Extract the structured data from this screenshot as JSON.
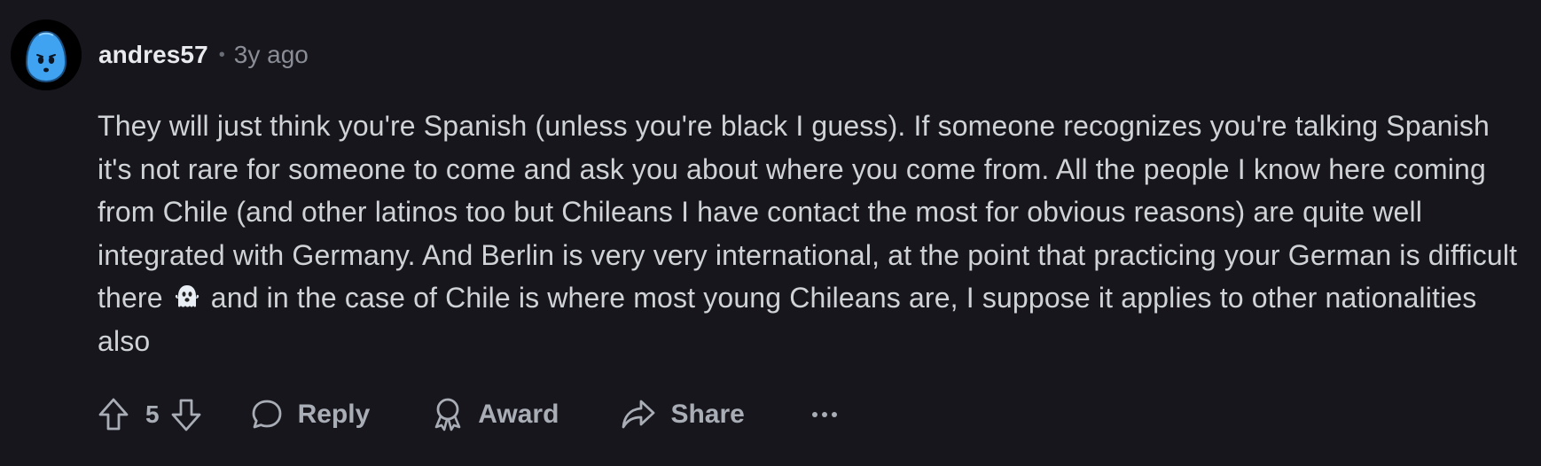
{
  "comment": {
    "author": "andres57",
    "separator": "•",
    "timestamp": "3y ago",
    "text_before_emoji": "They will just think you're Spanish (unless you're black I guess). If someone recognizes you're talking Spanish it's not rare for someone to come and ask you about where you come from. All the people I know here coming from Chile (and other latinos too but Chileans I have contact the most for obvious reasons) are quite well integrated with Germany. And Berlin is very very international, at the point that practicing your German is difficult there ",
    "emoji": "ghost-emoji",
    "text_after_emoji": " and in the case of Chile is where most young Chileans are, I suppose it applies to other nationalities also"
  },
  "actions": {
    "vote_count": "5",
    "reply_label": "Reply",
    "award_label": "Award",
    "share_label": "Share"
  },
  "icons": {
    "avatar": "snoo-avatar",
    "upvote": "arrow-up-icon",
    "downvote": "arrow-down-icon",
    "reply": "speech-bubble-icon",
    "award": "award-ribbon-icon",
    "share": "share-arrow-icon",
    "more": "ellipsis-icon"
  },
  "colors": {
    "background": "#17161d",
    "avatar_bg": "#000000",
    "avatar_head": "#3fa3f2",
    "text": "#d0d3d6",
    "muted": "#a9adb5"
  }
}
